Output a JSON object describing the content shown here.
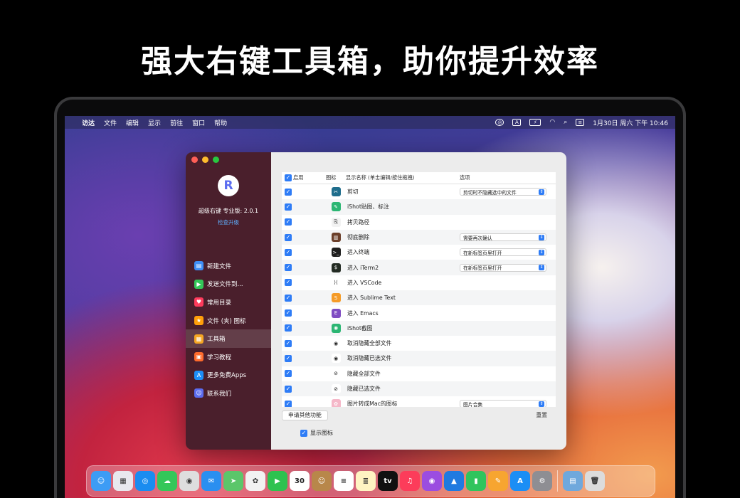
{
  "headline": "强大右键工具箱，助你提升效率",
  "menubar": {
    "apple": "",
    "items": [
      "访达",
      "文件",
      "编辑",
      "显示",
      "前往",
      "窗口",
      "帮助"
    ],
    "status_icons": [
      "ishot-icon",
      "input-a-icon",
      "battery-icon",
      "wifi-icon",
      "search-icon",
      "control-center-icon"
    ],
    "input_label": "A",
    "datetime": "1月30日 周六 下午 10:46"
  },
  "window": {
    "app_name_version": "超级右键 专业版: 2.0.1",
    "check_update": "检查升级",
    "logo_letter": "R",
    "sidebar": [
      {
        "label": "新建文件",
        "icon": "new-file-icon",
        "color": "#3d8ef7",
        "glyph": "▤"
      },
      {
        "label": "发送文件到...",
        "icon": "send-file-icon",
        "color": "#34c759",
        "glyph": "▶"
      },
      {
        "label": "常用目录",
        "icon": "heart-icon",
        "color": "#ff3b5c",
        "glyph": "♥"
      },
      {
        "label": "文件 (夹) 图标",
        "icon": "file-icon-icon",
        "color": "#ff9f0a",
        "glyph": "★"
      },
      {
        "label": "工具箱",
        "icon": "toolbox-icon",
        "color": "#f5a623",
        "glyph": "▦",
        "active": true
      },
      {
        "label": "学习教程",
        "icon": "tutorial-icon",
        "color": "#ff6b2c",
        "glyph": "▣"
      },
      {
        "label": "更多免费Apps",
        "icon": "app-store-icon",
        "color": "#1c8ef9",
        "glyph": "A"
      },
      {
        "label": "联系我们",
        "icon": "contact-icon",
        "color": "#5b6cf0",
        "glyph": "☺"
      }
    ],
    "table": {
      "headers": {
        "enable": "启用",
        "icon": "图标",
        "name": "显示名称 (单击编辑/按住拖拽)",
        "options": "选项"
      },
      "rows": [
        {
          "name": "剪切",
          "icon": "cut-icon",
          "color": "#1f6d8c",
          "glyph": "✂",
          "option": "剪切时不隐藏选中的文件"
        },
        {
          "name": "iShot贴图、标注",
          "icon": "ishot-pin-icon",
          "color": "#2bb673",
          "glyph": "✎",
          "option": ""
        },
        {
          "name": "拷贝路径",
          "icon": "copy-path-icon",
          "color": "#f2f2f2",
          "glyph": "⎘",
          "option": ""
        },
        {
          "name": "彻底删除",
          "icon": "delete-icon",
          "color": "#6b3f2a",
          "glyph": "▥",
          "option": "需要再次确认"
        },
        {
          "name": "进入终端",
          "icon": "terminal-icon",
          "color": "#1e1e1e",
          "glyph": ">_",
          "option": "在新标签页里打开"
        },
        {
          "name": "进入 iTerm2",
          "icon": "iterm2-icon",
          "color": "#222a22",
          "glyph": "$",
          "option": "在新标签页里打开"
        },
        {
          "name": "进入 VSCode",
          "icon": "vscode-icon",
          "color": "#ffffff",
          "glyph": "⟩⟨",
          "option": ""
        },
        {
          "name": "进入 Sublime Text",
          "icon": "sublime-icon",
          "color": "#f59b27",
          "glyph": "S",
          "option": ""
        },
        {
          "name": "进入 Emacs",
          "icon": "emacs-icon",
          "color": "#7f4cc2",
          "glyph": "E",
          "option": ""
        },
        {
          "name": "iShot截图",
          "icon": "ishot-icon",
          "color": "#2bb673",
          "glyph": "◉",
          "option": ""
        },
        {
          "name": "取消隐藏全部文件",
          "icon": "eye-icon",
          "color": "#ffffff",
          "glyph": "◉",
          "option": ""
        },
        {
          "name": "取消隐藏已选文件",
          "icon": "eye-icon",
          "color": "#ffffff",
          "glyph": "◉",
          "option": ""
        },
        {
          "name": "隐藏全部文件",
          "icon": "eye-slash-icon",
          "color": "#ffffff",
          "glyph": "⊘",
          "option": ""
        },
        {
          "name": "隐藏已选文件",
          "icon": "eye-slash-icon",
          "color": "#ffffff",
          "glyph": "⊘",
          "option": ""
        },
        {
          "name": "图片转成Mac的图标",
          "icon": "image-icon",
          "color": "#f5b7c8",
          "glyph": "✿",
          "option": "图片合集"
        }
      ]
    },
    "apply_label": "申请其他功能",
    "reset_label": "重置",
    "show_icon_label": "显示图标"
  },
  "dock": [
    {
      "name": "finder",
      "color": "#3d9cf5",
      "glyph": "☺"
    },
    {
      "name": "launchpad",
      "color": "#e8e8ee",
      "glyph": "▦"
    },
    {
      "name": "safari",
      "color": "#1a8cf0",
      "glyph": "◎"
    },
    {
      "name": "messages",
      "color": "#34c759",
      "glyph": "☁"
    },
    {
      "name": "screenshot",
      "color": "#dedede",
      "glyph": "◉"
    },
    {
      "name": "mail",
      "color": "#2a8ff0",
      "glyph": "✉"
    },
    {
      "name": "maps",
      "color": "#5bc66a",
      "glyph": "➤"
    },
    {
      "name": "photos",
      "color": "#f2f2f2",
      "glyph": "✿"
    },
    {
      "name": "facetime",
      "color": "#2ec24f",
      "glyph": "▶"
    },
    {
      "name": "calendar",
      "color": "#ffffff",
      "glyph": "30",
      "label": "30"
    },
    {
      "name": "contacts",
      "color": "#b8874a",
      "glyph": "☺"
    },
    {
      "name": "reminders",
      "color": "#ffffff",
      "glyph": "≡"
    },
    {
      "name": "notes",
      "color": "#fff4c2",
      "glyph": "≣"
    },
    {
      "name": "appletv",
      "color": "#111111",
      "glyph": "tv"
    },
    {
      "name": "music",
      "color": "#fc3c5a",
      "glyph": "♫"
    },
    {
      "name": "podcasts",
      "color": "#9b4de0",
      "glyph": "◉"
    },
    {
      "name": "keynote",
      "color": "#1f7ae0",
      "glyph": "▲"
    },
    {
      "name": "numbers",
      "color": "#30c45d",
      "glyph": "▮"
    },
    {
      "name": "pages",
      "color": "#f7a530",
      "glyph": "✎"
    },
    {
      "name": "app-store",
      "color": "#1b8ef5",
      "glyph": "A"
    },
    {
      "name": "system-preferences",
      "color": "#8e8e93",
      "glyph": "⚙"
    },
    {
      "name": "downloads-stack",
      "color": "#6fa8dc",
      "glyph": "▤"
    },
    {
      "name": "trash",
      "color": "#dcdcdc",
      "glyph": "🗑"
    }
  ]
}
